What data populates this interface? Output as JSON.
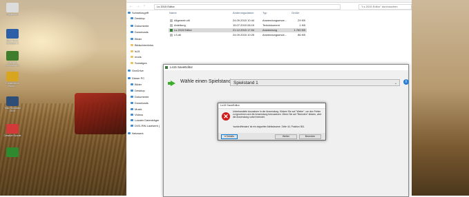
{
  "desktop": {
    "icons": [
      {
        "label": "Papierkorb",
        "color": "#dcdcdc"
      },
      {
        "label": "Euro Truck Simulator 2",
        "color": "#2d5fa8"
      },
      {
        "label": "Farming Simulator 15",
        "color": "#3d7d2b"
      },
      {
        "label": "Construction Simul...",
        "color": "#d8a520"
      },
      {
        "label": "Train Simulator 2015",
        "color": "#2f4e77"
      },
      {
        "label": "Creative Bundle",
        "color": "#d23a3a"
      },
      {
        "label": "",
        "color": "#2f8a2f"
      }
    ]
  },
  "explorer": {
    "path": "Ls 2015 Editor",
    "search_placeholder": "\"Ls 2015 Editor\" durchsuchen",
    "nav_buttons": "← → ↑",
    "nav_items": [
      {
        "label": "Schnellzugriff",
        "kind": "star"
      },
      {
        "label": "Desktop",
        "kind": "pc"
      },
      {
        "label": "Dokumente",
        "kind": "pc"
      },
      {
        "label": "Downloads",
        "kind": "pc"
      },
      {
        "label": "Bilder",
        "kind": "pc"
      },
      {
        "label": "Bildschirmfotos",
        "kind": "folder"
      },
      {
        "label": "ls15",
        "kind": "folder"
      },
      {
        "label": "mods",
        "kind": "folder"
      },
      {
        "label": "Sonstiges",
        "kind": "folder"
      },
      {
        "label": "OneDrive",
        "kind": "pc"
      },
      {
        "label": "Dieser PC",
        "kind": "pc"
      },
      {
        "label": "Bilder",
        "kind": "pc"
      },
      {
        "label": "Desktop",
        "kind": "pc"
      },
      {
        "label": "Dokumente",
        "kind": "pc"
      },
      {
        "label": "Downloads",
        "kind": "pc"
      },
      {
        "label": "Musik",
        "kind": "pc"
      },
      {
        "label": "Videos",
        "kind": "pc"
      },
      {
        "label": "Lokaler Datenträger",
        "kind": "pc"
      },
      {
        "label": "DVD-RW-Laufwerk (",
        "kind": "pc"
      },
      {
        "label": "Netzwerk",
        "kind": "pc"
      }
    ],
    "columns": {
      "name": "Name",
      "date": "Änderungsdatum",
      "type": "Typ",
      "size": "Größe"
    },
    "files": [
      {
        "name": "Allgemein.dll",
        "date": "24.09.2015 10:44",
        "type": "Anwendungserwe...",
        "size": "29 KB"
      },
      {
        "name": "Anleitung",
        "date": "15.07.2015 08:19",
        "type": "Textdokument",
        "size": "1 KB"
      },
      {
        "name": "Ls 2015 Editor",
        "date": "21.12.2015 17:04",
        "type": "Anwendung",
        "size": "1.760 KB"
      },
      {
        "name": "LS.dll",
        "date": "24.09.2015 10:25",
        "type": "Anwendungserwe...",
        "size": "86 KB"
      }
    ]
  },
  "editor": {
    "title": "Ls15 SaveEditor",
    "prompt": "Wähle einen Spielstand:",
    "selected_savegame": "Spielstand 1",
    "info_glyph": "i"
  },
  "dialog": {
    "title": "Ls15 SaveEditor",
    "message": "Unbehandelte Ausnahme in der Anwendung. Klicken Sie auf \"Weiter\", um den Fehler zu ignorieren und die Anwendung fortzusetzen. Wenn Sie auf \"Beenden\" klicken, wird die Anwendung sofort beendet.",
    "detail": "'workedHectars' ist ein doppelter Attributname. Zeile 44, Position 361.",
    "details_button": "Details",
    "continue_button": "Weiter",
    "quit_button": "Beenden",
    "error_glyph": "✕"
  }
}
